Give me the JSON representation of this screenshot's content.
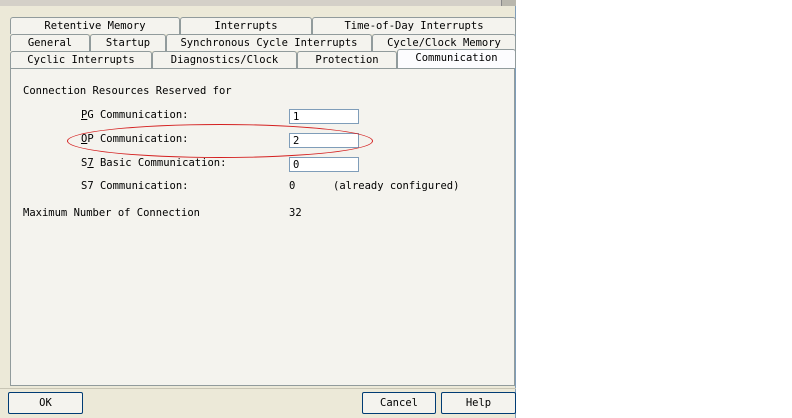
{
  "tabs": {
    "row1": [
      {
        "id": "retentive",
        "label": "Retentive Memory"
      },
      {
        "id": "interrupts",
        "label": "Interrupts"
      },
      {
        "id": "tod",
        "label": "Time-of-Day Interrupts"
      }
    ],
    "row2": [
      {
        "id": "general",
        "label": "General"
      },
      {
        "id": "startup",
        "label": "Startup"
      },
      {
        "id": "sync",
        "label": "Synchronous Cycle Interrupts"
      },
      {
        "id": "clock",
        "label": "Cycle/Clock Memory"
      }
    ],
    "row3": [
      {
        "id": "cyclic",
        "label": "Cyclic Interrupts"
      },
      {
        "id": "diag",
        "label": "Diagnostics/Clock"
      },
      {
        "id": "protection",
        "label": "Protection"
      },
      {
        "id": "communication",
        "label": "Communication",
        "active": true
      }
    ]
  },
  "communication": {
    "section_label": "Connection Resources Reserved for",
    "pg": {
      "label_underlined": "P",
      "label_rest": "G Communication:",
      "value": "1"
    },
    "op": {
      "label_underlined": "O",
      "label_rest": "P Communication:",
      "value": "2"
    },
    "s7basic": {
      "label_prefix": "S",
      "label_underlined": "7",
      "label_rest": " Basic Communication:",
      "value": "0"
    },
    "s7": {
      "label": "S7 Communication:",
      "value": "0",
      "note": "(already configured)"
    },
    "max": {
      "label": "Maximum Number of Connection",
      "value": "32"
    }
  },
  "buttons": {
    "ok": "OK",
    "cancel": "Cancel",
    "help": "Help"
  },
  "colors": {
    "annotation": "#d42020",
    "dialog_bg": "#ece9d8",
    "panel_bg": "#f4f3ee"
  }
}
